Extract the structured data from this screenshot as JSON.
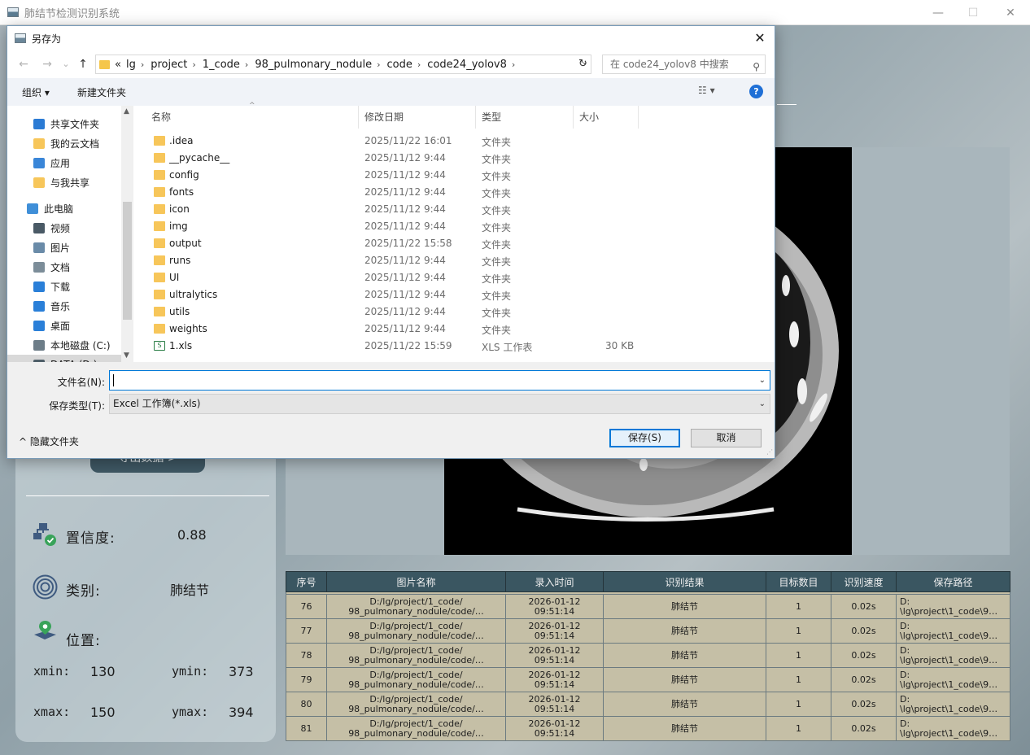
{
  "app": {
    "title": "肺结节检测识别系统",
    "minimize_glyph": "—",
    "maximize_glyph": "☐",
    "close_glyph": "✕",
    "export_button": "导出数据 >",
    "confidence_label": "置信度:",
    "confidence_value": "0.88",
    "class_label": "类别:",
    "class_value": "肺结节",
    "position_label": "位置:",
    "xmin_label": "xmin:",
    "xmin_value": "130",
    "ymin_label": "ymin:",
    "ymin_value": "373",
    "xmax_label": "xmax:",
    "xmax_value": "150",
    "ymax_label": "ymax:",
    "ymax_value": "394"
  },
  "table": {
    "headers": [
      "序号",
      "图片名称",
      "录入时间",
      "识别结果",
      "目标数目",
      "识别速度",
      "保存路径"
    ],
    "rows": [
      {
        "id": "76",
        "name": "D:/lg/project/1_code/\n98_pulmonary_nodule/code/…",
        "time": "2026-01-12\n09:51:14",
        "result": "肺结节",
        "count": "1",
        "speed": "0.02s",
        "path": "D:\n\\lg\\project\\1_code\\9…"
      },
      {
        "id": "77",
        "name": "D:/lg/project/1_code/\n98_pulmonary_nodule/code/…",
        "time": "2026-01-12\n09:51:14",
        "result": "肺结节",
        "count": "1",
        "speed": "0.02s",
        "path": "D:\n\\lg\\project\\1_code\\9…"
      },
      {
        "id": "78",
        "name": "D:/lg/project/1_code/\n98_pulmonary_nodule/code/…",
        "time": "2026-01-12\n09:51:14",
        "result": "肺结节",
        "count": "1",
        "speed": "0.02s",
        "path": "D:\n\\lg\\project\\1_code\\9…"
      },
      {
        "id": "79",
        "name": "D:/lg/project/1_code/\n98_pulmonary_nodule/code/…",
        "time": "2026-01-12\n09:51:14",
        "result": "肺结节",
        "count": "1",
        "speed": "0.02s",
        "path": "D:\n\\lg\\project\\1_code\\9…"
      },
      {
        "id": "80",
        "name": "D:/lg/project/1_code/\n98_pulmonary_nodule/code/…",
        "time": "2026-01-12\n09:51:14",
        "result": "肺结节",
        "count": "1",
        "speed": "0.02s",
        "path": "D:\n\\lg\\project\\1_code\\9…"
      },
      {
        "id": "81",
        "name": "D:/lg/project/1_code/\n98_pulmonary_nodule/code/…",
        "time": "2026-01-12\n09:51:14",
        "result": "肺结节",
        "count": "1",
        "speed": "0.02s",
        "path": "D:\n\\lg\\project\\1_code\\9…"
      }
    ]
  },
  "dialog": {
    "title": "另存为",
    "close_glyph": "✕",
    "back_glyph": "←",
    "forward_glyph": "→",
    "recent_glyph": "⌄",
    "up_glyph": "↑",
    "breadcrumbs": [
      "«",
      "lg",
      "project",
      "1_code",
      "98_pulmonary_nodule",
      "code",
      "code24_yolov8"
    ],
    "search_placeholder": "在 code24_yolov8 中搜索",
    "organize": "组织 ▾",
    "new_folder": "新建文件夹",
    "help": "?",
    "nav_items": [
      {
        "label": "共享文件夹",
        "icon": "share-icon",
        "color": "#2b7bd4"
      },
      {
        "label": "我的云文档",
        "icon": "folder-icon",
        "color": "#f7c65a"
      },
      {
        "label": "应用",
        "icon": "apps-icon",
        "color": "#3a86d8"
      },
      {
        "label": "与我共享",
        "icon": "folder-icon",
        "color": "#f7c65a"
      },
      {
        "label": "此电脑",
        "icon": "computer-icon",
        "color": "#3f8fd8"
      },
      {
        "label": "视频",
        "icon": "video-icon",
        "color": "#4a5a66"
      },
      {
        "label": "图片",
        "icon": "picture-icon",
        "color": "#6a8ba8"
      },
      {
        "label": "文档",
        "icon": "document-icon",
        "color": "#7c8d99"
      },
      {
        "label": "下载",
        "icon": "download-icon",
        "color": "#2a7fd8"
      },
      {
        "label": "音乐",
        "icon": "music-icon",
        "color": "#2a7fd8"
      },
      {
        "label": "桌面",
        "icon": "desktop-icon",
        "color": "#2a7fd8"
      },
      {
        "label": "本地磁盘 (C:)",
        "icon": "drive-icon",
        "color": "#6d7d88"
      },
      {
        "label": "DATA (D:)",
        "icon": "drive-icon",
        "color": "#4e5e68"
      }
    ],
    "columns": [
      "名称",
      "修改日期",
      "类型",
      "大小"
    ],
    "files": [
      {
        "name": ".idea",
        "date": "2025/11/22 16:01",
        "type": "文件夹",
        "size": "",
        "kind": "folder"
      },
      {
        "name": "__pycache__",
        "date": "2025/11/12 9:44",
        "type": "文件夹",
        "size": "",
        "kind": "folder"
      },
      {
        "name": "config",
        "date": "2025/11/12 9:44",
        "type": "文件夹",
        "size": "",
        "kind": "folder"
      },
      {
        "name": "fonts",
        "date": "2025/11/12 9:44",
        "type": "文件夹",
        "size": "",
        "kind": "folder"
      },
      {
        "name": "icon",
        "date": "2025/11/12 9:44",
        "type": "文件夹",
        "size": "",
        "kind": "folder"
      },
      {
        "name": "img",
        "date": "2025/11/12 9:44",
        "type": "文件夹",
        "size": "",
        "kind": "folder"
      },
      {
        "name": "output",
        "date": "2025/11/22 15:58",
        "type": "文件夹",
        "size": "",
        "kind": "folder"
      },
      {
        "name": "runs",
        "date": "2025/11/12 9:44",
        "type": "文件夹",
        "size": "",
        "kind": "folder"
      },
      {
        "name": "UI",
        "date": "2025/11/12 9:44",
        "type": "文件夹",
        "size": "",
        "kind": "folder"
      },
      {
        "name": "ultralytics",
        "date": "2025/11/12 9:44",
        "type": "文件夹",
        "size": "",
        "kind": "folder"
      },
      {
        "name": "utils",
        "date": "2025/11/12 9:44",
        "type": "文件夹",
        "size": "",
        "kind": "folder"
      },
      {
        "name": "weights",
        "date": "2025/11/12 9:44",
        "type": "文件夹",
        "size": "",
        "kind": "folder"
      },
      {
        "name": "1.xls",
        "date": "2025/11/22 15:59",
        "type": "XLS 工作表",
        "size": "30 KB",
        "kind": "xls"
      }
    ],
    "filename_label": "文件名(N):",
    "filename_value": "",
    "filetype_label": "保存类型(T):",
    "filetype_value": "Excel 工作簿(*.xls)",
    "hide_folders": "隐藏文件夹",
    "save_button": "保存(S)",
    "cancel_button": "取消"
  }
}
